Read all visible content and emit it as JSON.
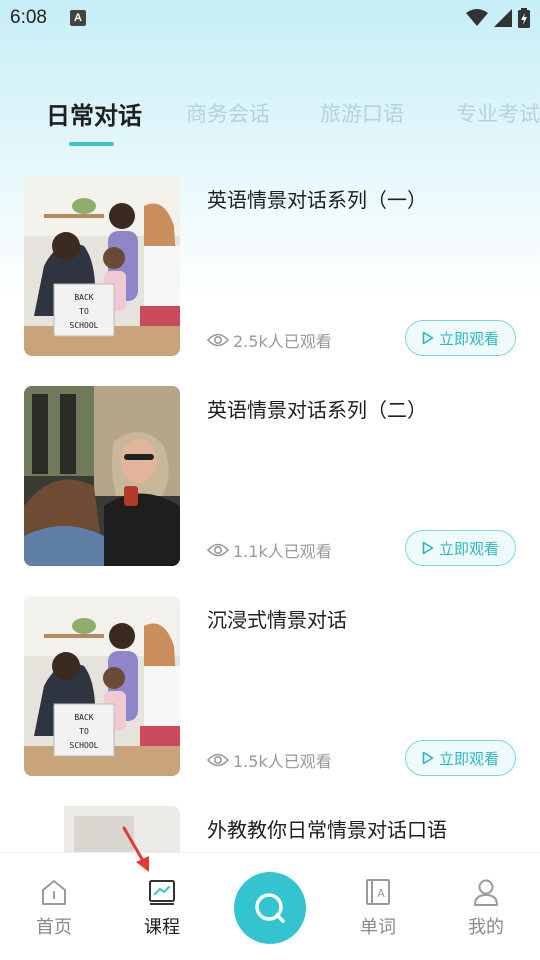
{
  "status_bar": {
    "time": "6:08",
    "notification_letter": "A"
  },
  "tabs": [
    {
      "label": "日常对话",
      "active": true
    },
    {
      "label": "商务会话",
      "active": false
    },
    {
      "label": "旅游口语",
      "active": false
    },
    {
      "label": "专业考试",
      "active": false
    }
  ],
  "courses": [
    {
      "title": "英语情景对话系列（一）",
      "views": "2.5k人已观看",
      "button": "立即观看",
      "thumbnail": "back-to-school-photo"
    },
    {
      "title": "英语情景对话系列（二）",
      "views": "1.1k人已观看",
      "button": "立即观看",
      "thumbnail": "women-with-phone-photo"
    },
    {
      "title": "沉浸式情景对话",
      "views": "1.5k人已观看",
      "button": "立即观看",
      "thumbnail": "back-to-school-photo"
    },
    {
      "title": "外教教你日常情景对话口语",
      "views": "",
      "button": "",
      "thumbnail": "classroom-photo"
    }
  ],
  "thumbnail_sign": {
    "line1": "BACK",
    "line2": "TO",
    "line3": "SCHOOL"
  },
  "bottom_nav": {
    "home": "首页",
    "courses": "课程",
    "words": "单词",
    "profile": "我的"
  },
  "colors": {
    "accent": "#33c4d0",
    "tab_inactive": "#b4d4d8",
    "annotation_arrow": "#e53935"
  }
}
